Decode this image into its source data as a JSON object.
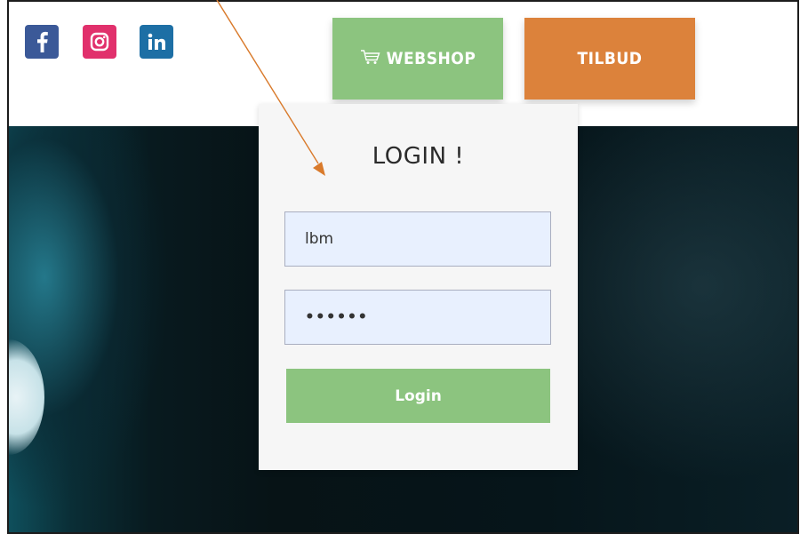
{
  "social": {
    "facebook_icon": "facebook-icon",
    "instagram_icon": "instagram-icon",
    "linkedin_icon": "linkedin-icon",
    "colors": {
      "facebook": "#3b5998",
      "instagram": "#e1306c",
      "linkedin": "#1d6fa5"
    }
  },
  "nav": {
    "webshop_label": "WEBSHOP",
    "webshop_icon": "cart-icon",
    "tilbud_label": "TILBUD",
    "colors": {
      "webshop": "#8cc47f",
      "tilbud": "#dc823b"
    }
  },
  "login": {
    "title": "LOGIN !",
    "username_value": "lbm",
    "password_value": "••••••",
    "submit_label": "Login",
    "field_background": "#e8f0fe"
  },
  "annotation": {
    "arrow_color": "#d97a2b"
  }
}
